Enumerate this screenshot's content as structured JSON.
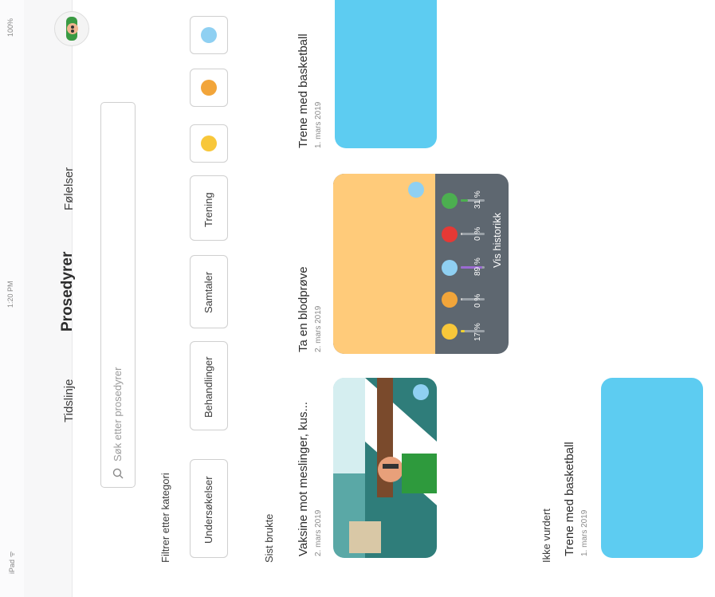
{
  "status": {
    "device": "iPad ᯤ",
    "time": "1:20 PM",
    "battery": "100%"
  },
  "nav": {
    "tabs": [
      "Tidslinje",
      "Prosedyrer",
      "Følelser"
    ],
    "active": 1
  },
  "search": {
    "placeholder": "Søk etter prosedyrer"
  },
  "filter": {
    "heading": "Filtrer etter kategori",
    "categories": [
      "Undersøkelser",
      "Behandlinger",
      "Samtaler",
      "Trening"
    ]
  },
  "sections": {
    "recent": "Sist brukte",
    "unrated": "Ikke vurdert"
  },
  "cards": [
    {
      "title": "Vaksine mot meslinger, kus...",
      "date": "2. mars 2019"
    },
    {
      "title": "Ta en blodprøve",
      "date": "2. mars 2019",
      "stats": [
        "17 %",
        "0 %",
        "89 %",
        "0 %",
        "31 %"
      ],
      "stat_values": [
        17,
        0,
        89,
        0,
        31
      ],
      "history_label": "Vis historikk"
    },
    {
      "title": "Trene med basketball",
      "date": "1. mars 2019"
    }
  ],
  "unrated_card": {
    "title": "Trene med basketball",
    "date": "1. mars 2019"
  },
  "colors": {
    "blue": "#5dccf1",
    "orange": "#ffcb7a",
    "panel": "#5e6770",
    "accent_yellow": "#f2d12b",
    "accent_purple": "#9b6bd2",
    "accent_green": "#4caf50",
    "accent_red": "#e53935"
  }
}
